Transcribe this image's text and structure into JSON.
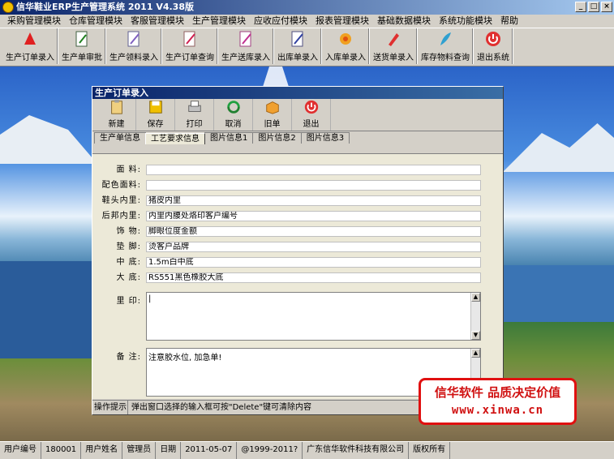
{
  "window": {
    "title": "信华鞋业ERP生产管理系统  2011 V4.38版"
  },
  "menu": [
    "采购管理模块",
    "仓库管理模块",
    "客服管理模块",
    "生产管理模块",
    "应收应付模块",
    "报表管理模块",
    "基础数据模块",
    "系统功能模块",
    "帮助"
  ],
  "toolbar": [
    "生产订单录入",
    "生产单审批",
    "生产领料录入",
    "生产订单查询",
    "生产送库录入",
    "出库单录入",
    "入库单录入",
    "送货单录入",
    "库存物料查询",
    "退出系统"
  ],
  "child": {
    "title": "生产订单录入",
    "buttons": [
      "新建",
      "保存",
      "打印",
      "取消",
      "旧单",
      "退出"
    ],
    "tabs": [
      "生产单信息",
      "工艺要求信息",
      "图片信息1",
      "图片信息2",
      "图片信息3"
    ],
    "fields": [
      {
        "label": "面 料:",
        "value": ""
      },
      {
        "label": "配色面料:",
        "value": ""
      },
      {
        "label": "鞋头内里:",
        "value": "猪皮内里"
      },
      {
        "label": "后邦内里:",
        "value": "内里内腰处烙印客户编号"
      },
      {
        "label": "饰 物:",
        "value": "脚眼位度金额"
      },
      {
        "label": "垫 脚:",
        "value": "烫客户品牌"
      },
      {
        "label": "中 底:",
        "value": "1.5m白中底"
      },
      {
        "label": "大 底:",
        "value": "RS551黑色橡胶大底"
      }
    ],
    "imprint": {
      "label": "里 印:",
      "value": "|"
    },
    "note": {
      "label": "备 注:",
      "value": "注意胶水位, 加急单!"
    },
    "status": {
      "label": "操作提示",
      "text": "弹出窗口选择的输入框可按\"Delete\"键可清除内容"
    }
  },
  "banner": {
    "line1": "信华软件 品质决定价值",
    "line2": "www.xinwa.cn"
  },
  "statusbar": [
    "用户编号",
    "180001",
    "用户姓名",
    "管理员",
    "日期",
    "2011-05-07",
    "@1999-2011?",
    "广东信华软件科技有限公司",
    "版权所有"
  ]
}
